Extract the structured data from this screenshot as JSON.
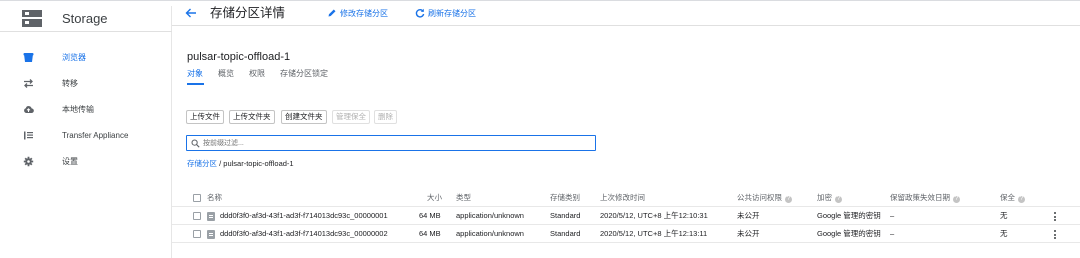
{
  "app": {
    "title": "Storage"
  },
  "sidebar": {
    "items": [
      {
        "label": "浏览器",
        "icon": "bucket-icon",
        "active": true
      },
      {
        "label": "转移",
        "icon": "transfer-icon",
        "active": false
      },
      {
        "label": "本地传输",
        "icon": "cloud-upload-icon",
        "active": false
      },
      {
        "label": "Transfer Appliance",
        "icon": "appliance-icon",
        "active": false
      },
      {
        "label": "设置",
        "icon": "gear-icon",
        "active": false
      }
    ]
  },
  "header": {
    "title": "存储分区详情",
    "edit_label": "修改存储分区",
    "refresh_label": "刷新存储分区"
  },
  "bucket": {
    "name": "pulsar-topic-offload-1"
  },
  "tabs": [
    "对象",
    "概览",
    "权限",
    "存储分区锁定"
  ],
  "toolbar": {
    "upload_files": "上传文件",
    "upload_folder": "上传文件夹",
    "create_folder": "创建文件夹",
    "manage_holds": "管理保全",
    "delete": "删除"
  },
  "filter": {
    "placeholder": "按前缀过滤..."
  },
  "breadcrumb": {
    "root": "存储分区",
    "separator": "/",
    "current": "pulsar-topic-offload-1"
  },
  "table": {
    "headers": {
      "name": "名称",
      "size": "大小",
      "type": "类型",
      "storage_class": "存储类别",
      "modified": "上次修改时间",
      "public_access": "公共访问权限",
      "encryption": "加密",
      "retention": "保留政策失效日期",
      "hold": "保全"
    },
    "rows": [
      {
        "name": "ddd0f3f0-af3d-43f1-ad3f-f714013dc93c_00000001",
        "size": "64 MB",
        "type": "application/unknown",
        "storage_class": "Standard",
        "modified": "2020/5/12, UTC+8 上午12:10:31",
        "public_access": "未公开",
        "encryption": "Google 管理的密钥",
        "retention": "–",
        "hold": "无"
      },
      {
        "name": "ddd0f3f0-af3d-43f1-ad3f-f714013dc93c_00000002",
        "size": "64 MB",
        "type": "application/unknown",
        "storage_class": "Standard",
        "modified": "2020/5/12, UTC+8 上午12:13:11",
        "public_access": "未公开",
        "encryption": "Google 管理的密钥",
        "retention": "–",
        "hold": "无"
      }
    ]
  },
  "colors": {
    "accent": "#1a73e8",
    "text": "#202124",
    "muted": "#5f6368"
  }
}
